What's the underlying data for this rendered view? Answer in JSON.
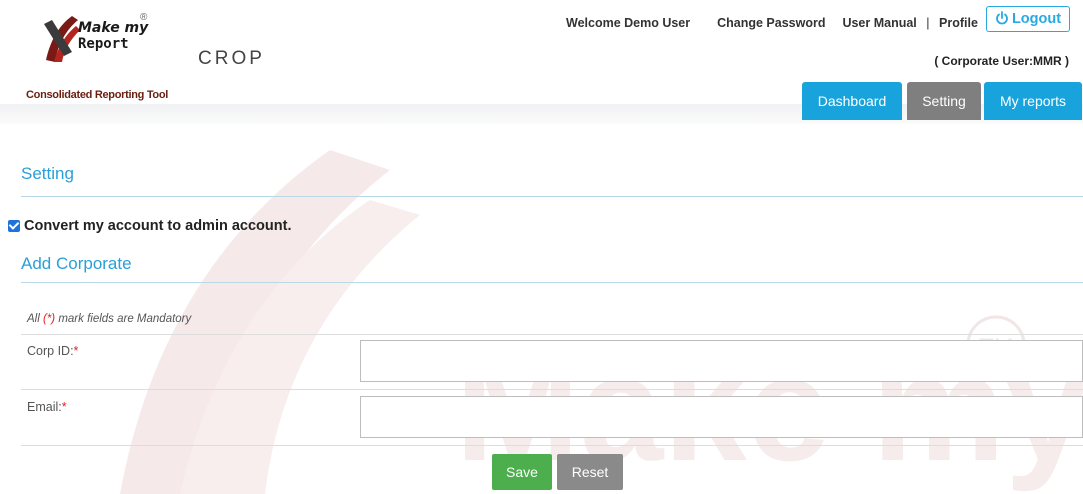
{
  "logo": {
    "line1": "Make my",
    "line2": "Report",
    "reg": "®",
    "product": "CROP",
    "tagline": "Consolidated Reporting Tool"
  },
  "topnav": {
    "welcome": "Welcome Demo User",
    "change_password": "Change Password",
    "user_manual": "User Manual",
    "separator": "|",
    "profile": "Profile",
    "logout": "Logout",
    "corporate_user": "( Corporate User:MMR )"
  },
  "tabs": {
    "dashboard": "Dashboard",
    "setting": "Setting",
    "my_reports": "My reports"
  },
  "page": {
    "title": "Setting",
    "checkbox_label": "Convert my account to admin account.",
    "checkbox_checked": true,
    "section_title": "Add Corporate"
  },
  "form": {
    "note_prefix": "All ",
    "note_mark": "(*)",
    "note_suffix": " mark fields are Mandatory",
    "corp_id_label": "Corp ID:",
    "email_label": "Email:",
    "required_mark": "*",
    "corp_id_value": "",
    "email_value": ""
  },
  "buttons": {
    "save": "Save",
    "reset": "Reset"
  },
  "watermark": {
    "text": "Make my",
    "tm": "TM"
  },
  "colors": {
    "accent": "#19a3dc",
    "active_tab": "#7f7f7f",
    "save": "#4cae4c",
    "reset": "#8a8a8a",
    "required": "#e02020"
  }
}
